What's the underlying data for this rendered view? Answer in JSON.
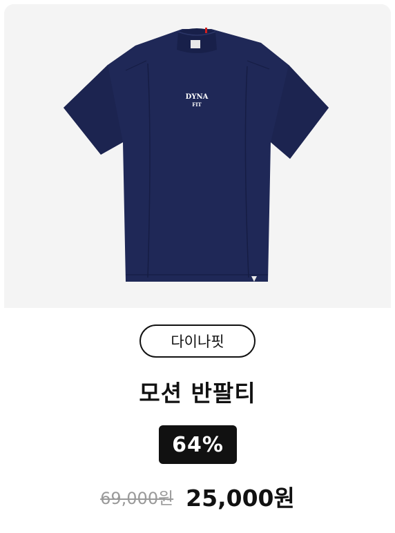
{
  "product": {
    "brand": "다이나핏",
    "name": "모션 반팔티",
    "discount": "64%",
    "original_price": "69,000원",
    "sale_price": "25,000원",
    "shirt_print": [
      "DYNA",
      "FIT"
    ],
    "image_bg": "#f4f4f4",
    "shirt_color": "#1f2857"
  }
}
